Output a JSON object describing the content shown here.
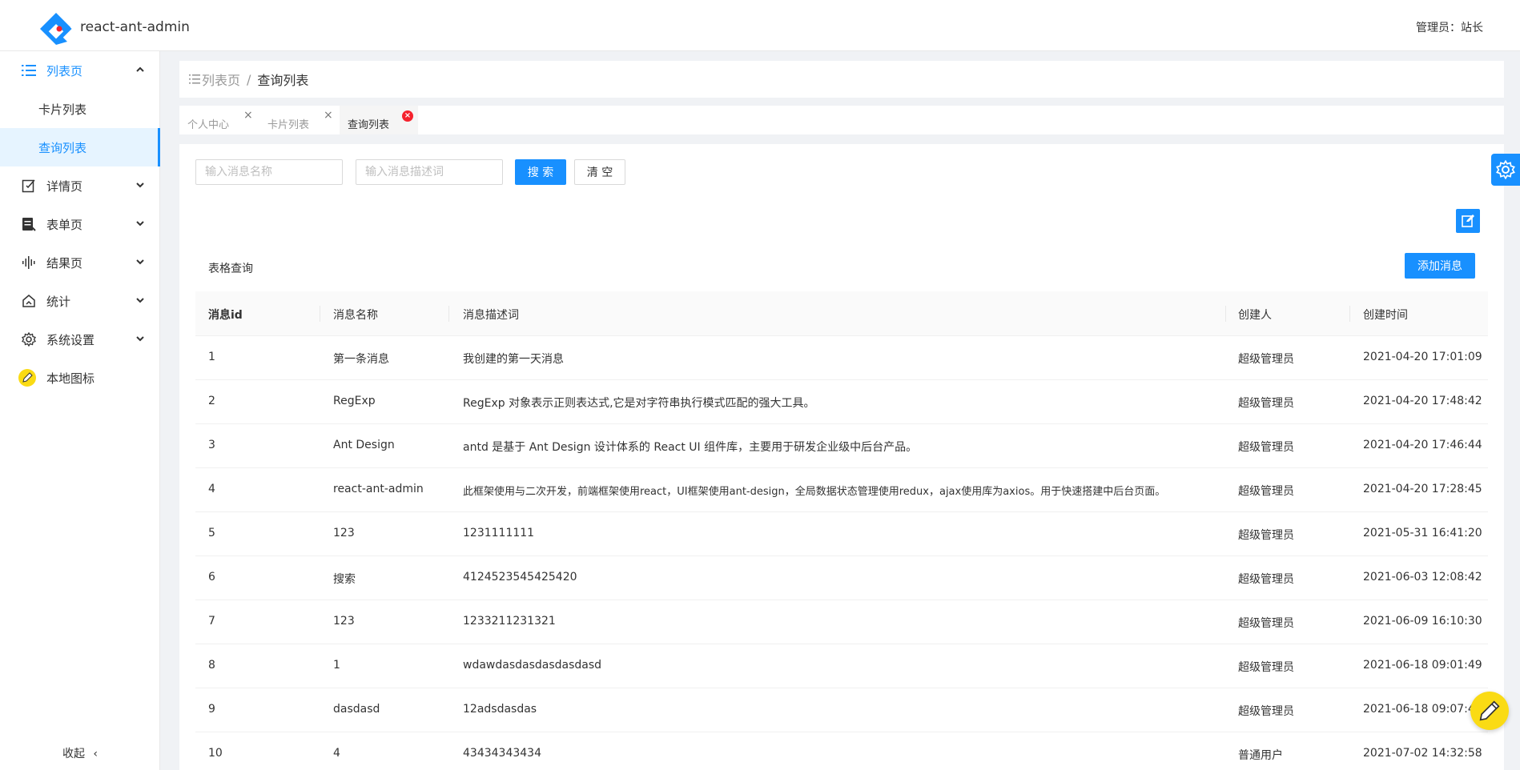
{
  "header": {
    "app_title": "react-ant-admin",
    "admin_info": "管理员：站长"
  },
  "sidebar": {
    "menu": [
      {
        "label": "列表页",
        "icon": "list-icon",
        "open": true
      },
      {
        "label": "详情页",
        "icon": "edit-square-icon"
      },
      {
        "label": "表单页",
        "icon": "form-icon"
      },
      {
        "label": "结果页",
        "icon": "audio-bars-icon"
      },
      {
        "label": "统计",
        "icon": "home-chart-icon"
      },
      {
        "label": "系统设置",
        "icon": "gear-icon"
      },
      {
        "label": "本地图标",
        "icon": "pencil-badge-icon"
      }
    ],
    "submenu": [
      {
        "label": "卡片列表"
      },
      {
        "label": "查询列表",
        "active": true
      }
    ],
    "collapse_label": "收起",
    "collapse_arrow": "‹"
  },
  "breadcrumb": {
    "first": "列表页",
    "separator": "/",
    "current": "查询列表"
  },
  "tabs": [
    {
      "label": "个人中心"
    },
    {
      "label": "卡片列表"
    },
    {
      "label": "查询列表",
      "active": true
    }
  ],
  "search": {
    "name_placeholder": "输入消息名称",
    "desc_placeholder": "输入消息描述词",
    "search_label": "搜 索",
    "clear_label": "清 空"
  },
  "table": {
    "title": "表格查询",
    "add_label": "添加消息",
    "columns": [
      "消息id",
      "消息名称",
      "消息描述词",
      "创建人",
      "创建时间"
    ],
    "rows": [
      [
        "1",
        "第一条消息",
        "我创建的第一天消息",
        "超级管理员",
        "2021-04-20 17:01:09"
      ],
      [
        "2",
        "RegExp",
        "RegExp 对象表示正则表达式,它是对字符串执行模式匹配的强大工具。",
        "超级管理员",
        "2021-04-20 17:48:42"
      ],
      [
        "3",
        "Ant Design",
        "antd 是基于 Ant Design 设计体系的 React UI 组件库，主要用于研发企业级中后台产品。",
        "超级管理员",
        "2021-04-20 17:46:44"
      ],
      [
        "4",
        "react-ant-admin",
        "此框架使用与二次开发，前端框架使用react，UI框架使用ant-design，全局数据状态管理使用redux，ajax使用库为axios。用于快速搭建中后台页面。",
        "超级管理员",
        "2021-04-20 17:28:45"
      ],
      [
        "5",
        "123",
        "1231111111",
        "超级管理员",
        "2021-05-31 16:41:20"
      ],
      [
        "6",
        "搜索",
        "4124523545425420",
        "超级管理员",
        "2021-06-03 12:08:42"
      ],
      [
        "7",
        "123",
        "1233211231321",
        "超级管理员",
        "2021-06-09 16:10:30"
      ],
      [
        "8",
        "1",
        "wdawdasdasdasdasdasd",
        "超级管理员",
        "2021-06-18 09:01:49"
      ],
      [
        "9",
        "dasdasd",
        "12adsdasdas",
        "超级管理员",
        "2021-06-18 09:07:49"
      ],
      [
        "10",
        "4",
        "43434343434",
        "普通用户",
        "2021-07-02 14:32:58"
      ]
    ]
  },
  "colors": {
    "primary": "#1890ff",
    "close_red": "#f5222d",
    "fab_yellow": "#fadb14"
  }
}
